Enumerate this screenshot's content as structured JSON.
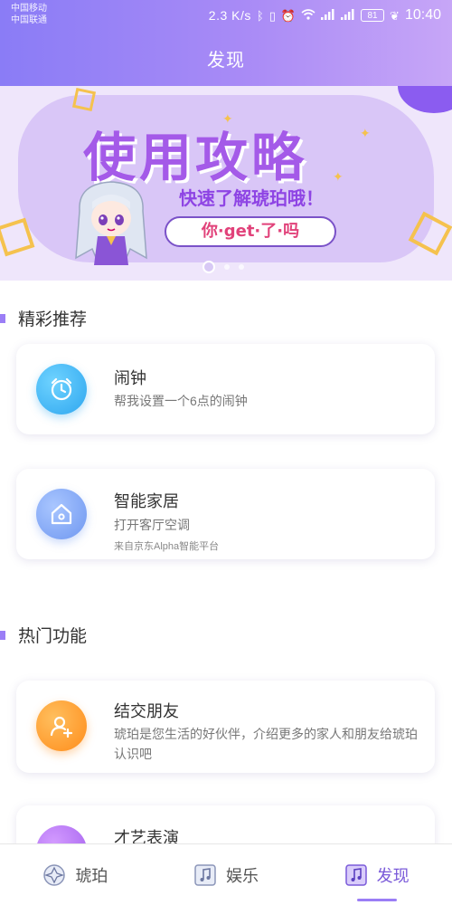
{
  "status_bar": {
    "carrier1": "中国移动",
    "carrier2": "中国联通",
    "speed": "2.3 K/s",
    "battery": "81",
    "time": "10:40"
  },
  "header": {
    "title": "发现"
  },
  "banner": {
    "headline": "使用攻略",
    "subtitle": "快速了解琥珀哦！",
    "pill": "你·get·了·吗",
    "dots": 3,
    "active_dot": 0
  },
  "sections": {
    "recommended": {
      "title": "精彩推荐",
      "cards": [
        {
          "title": "闹钟",
          "desc": "帮我设置一个6点的闹钟",
          "icon": "alarm-clock-icon"
        },
        {
          "title": "智能家居",
          "desc": "打开客厅空调",
          "source": "来自京东Alpha智能平台",
          "icon": "home-icon"
        }
      ]
    },
    "popular": {
      "title": "热门功能",
      "cards": [
        {
          "title": "结交朋友",
          "desc": "琥珀是您生活的好伙伴，介绍更多的家人和朋友给琥珀认识吧",
          "icon": "add-friend-icon"
        },
        {
          "title": "才艺表演",
          "icon": "talent-icon"
        }
      ]
    }
  },
  "tabbar": {
    "tabs": [
      {
        "label": "琥珀",
        "icon": "amber-icon"
      },
      {
        "label": "娱乐",
        "icon": "music-note-icon"
      },
      {
        "label": "发现",
        "icon": "discover-icon"
      }
    ],
    "active_index": 2
  },
  "colors": {
    "header_start": "#8a7cf6",
    "header_end": "#c7a6f7",
    "accent": "#9b7ef6",
    "alarm_icon": "#3fb6f3",
    "home_icon": "#7aa8f5",
    "friend_icon": "#ff9a2e",
    "talent_icon": "#b072f0"
  }
}
